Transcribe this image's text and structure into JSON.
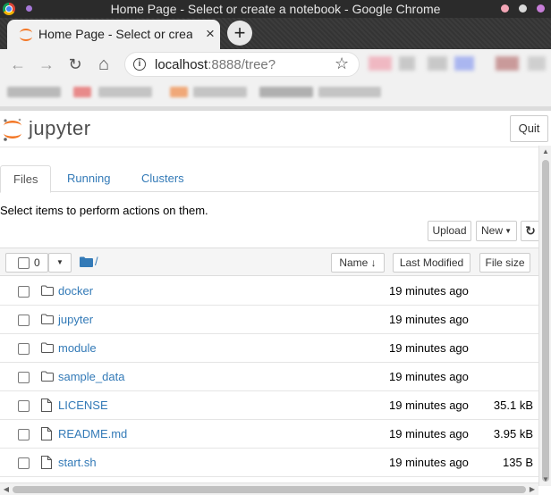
{
  "window": {
    "title": "Home Page - Select or create a notebook - Google Chrome"
  },
  "browser": {
    "tab_title": "Home Page - Select or create a notebook",
    "tab_close": "×",
    "new_tab": "+",
    "url_host": "localhost",
    "url_rest": ":8888/tree?",
    "info_glyph": "i",
    "nav": {
      "back": "←",
      "forward": "→",
      "reload": "↻",
      "home": "⌂"
    },
    "star": "☆"
  },
  "jupyter": {
    "logo_text": "jupyter",
    "quit_label": "Quit",
    "tabs": [
      {
        "label": "Files",
        "active": true
      },
      {
        "label": "Running",
        "active": false
      },
      {
        "label": "Clusters",
        "active": false
      }
    ],
    "instructions": "Select items to perform actions on them.",
    "upload_label": "Upload",
    "new_label": "New",
    "refresh_glyph": "↻",
    "selected_count": "0",
    "breadcrumb_root": "/",
    "columns": {
      "name": "Name",
      "name_sort": "↓",
      "last_modified": "Last Modified",
      "file_size": "File size"
    },
    "items": [
      {
        "name": "docker",
        "type": "folder",
        "modified": "19 minutes ago",
        "size": ""
      },
      {
        "name": "jupyter",
        "type": "folder",
        "modified": "19 minutes ago",
        "size": ""
      },
      {
        "name": "module",
        "type": "folder",
        "modified": "19 minutes ago",
        "size": ""
      },
      {
        "name": "sample_data",
        "type": "folder",
        "modified": "19 minutes ago",
        "size": ""
      },
      {
        "name": "LICENSE",
        "type": "file",
        "modified": "19 minutes ago",
        "size": "35.1 kB"
      },
      {
        "name": "README.md",
        "type": "file",
        "modified": "19 minutes ago",
        "size": "3.95 kB"
      },
      {
        "name": "start.sh",
        "type": "file",
        "modified": "19 minutes ago",
        "size": "135 B"
      }
    ]
  },
  "colors": {
    "link": "#337ab7",
    "jupyter_orange": "#f37726",
    "chrome_dark": "#2b2b2b"
  }
}
